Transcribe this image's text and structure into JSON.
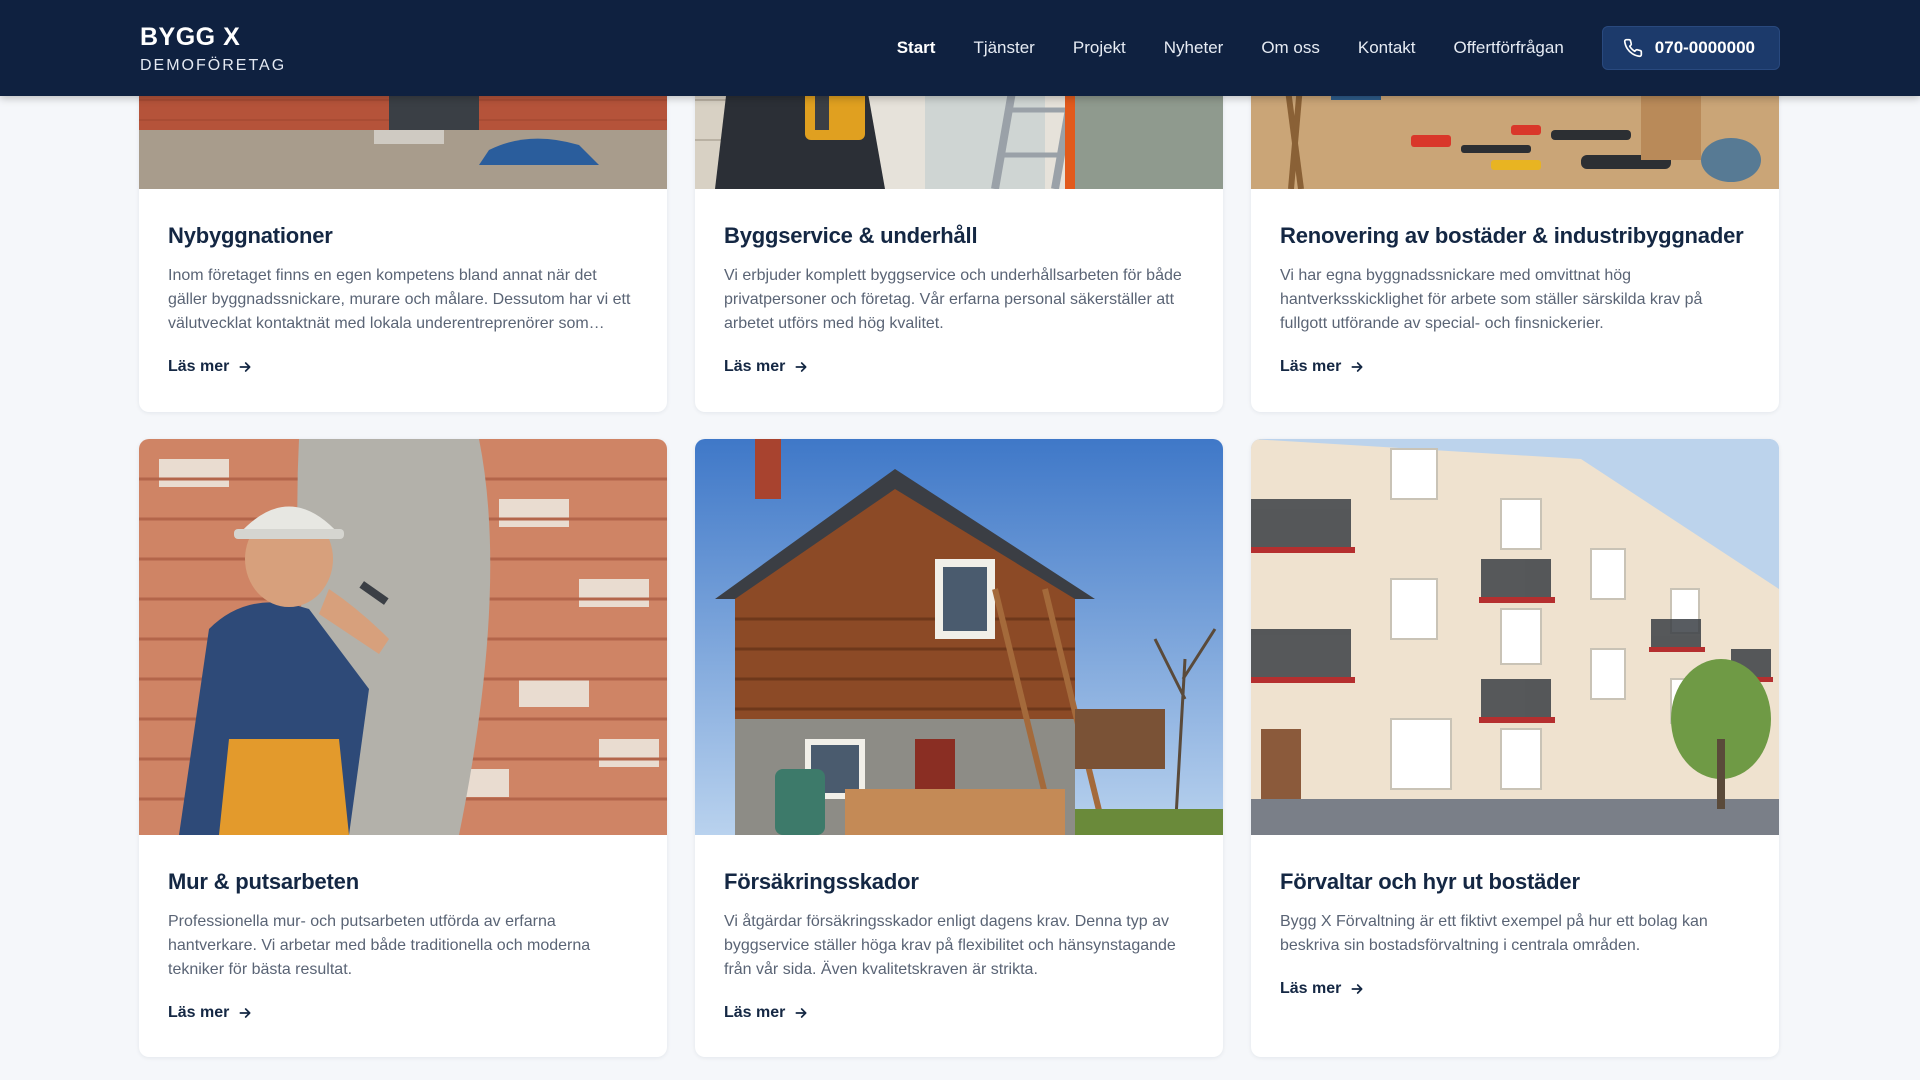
{
  "brand": {
    "name": "BYGG X",
    "subtitle": "DEMOFÖRETAG"
  },
  "nav": {
    "items": [
      "Start",
      "Tjänster",
      "Projekt",
      "Nyheter",
      "Om oss",
      "Kontakt",
      "Offertförfrågan"
    ],
    "active": "Start",
    "phone": "070-0000000"
  },
  "colors": {
    "header": "#0f2140",
    "accent_button": "#1c3a6b",
    "page_bg": "#f5f7fa"
  },
  "cards": [
    {
      "title": "Nybyggnationer",
      "text": "Inom företaget finns en egen kompetens bland annat när det gäller byggnadssnickare, murare och målare. Dessutom har vi ett välutvecklat kontaktnät med lokala underentreprenörer som kompletterar vår verksamhet.",
      "link": "Läs mer",
      "image": "new-brick-house-image"
    },
    {
      "title": "Byggservice & underhåll",
      "text": "Vi erbjuder komplett byggservice och underhållsarbeten för både privatpersoner och företag. Vår erfarna personal säkerställer att arbetet utförs med hög kvalitet.",
      "link": "Läs mer",
      "image": "worker-with-ladder-image"
    },
    {
      "title": "Renovering av bostäder & industribyggnader",
      "text": "Vi har egna byggnadssnickare med omvittnat hög hantverksskicklighet för arbete som ställer särskilda krav på fullgott utförande av special- och finsnickerier.",
      "link": "Läs mer",
      "image": "tools-on-floor-image"
    },
    {
      "title": "Mur & putsarbeten",
      "text": "Professionella mur- och putsarbeten utförda av erfarna hantverkare. Vi arbetar med både traditionella och moderna tekniker för bästa resultat.",
      "link": "Läs mer",
      "image": "mason-plastering-wall-image"
    },
    {
      "title": "Försäkringsskador",
      "text": "Vi åtgärdar försäkringsskador enligt dagens krav. Denna typ av byggservice ställer höga krav på flexibilitet och hänsynstagande från vår sida. Även kvalitetskraven är strikta.",
      "link": "Läs mer",
      "image": "wooden-house-renovation-image"
    },
    {
      "title": "Förvaltar och hyr ut bostäder",
      "text": "Bygg X Förvaltning är ett fiktivt exempel på hur ett bolag kan beskriva sin bostadsförvaltning i centrala områden.",
      "link": "Läs mer",
      "image": "apartment-building-image"
    }
  ]
}
